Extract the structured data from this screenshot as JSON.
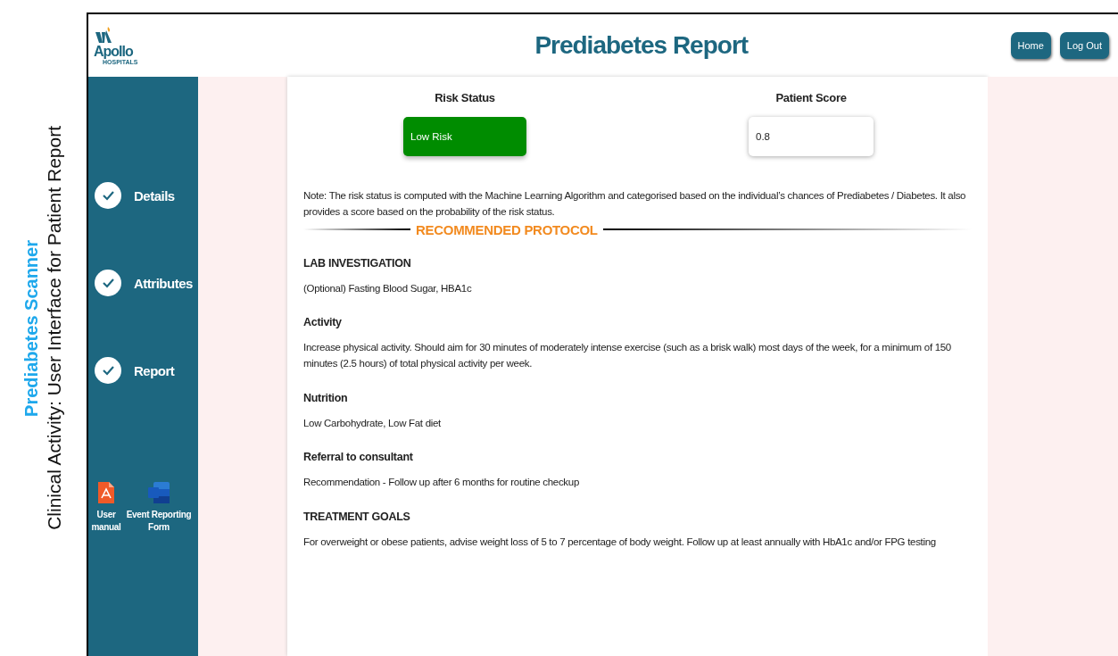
{
  "caption": {
    "title": "Prediabetes Scanner",
    "subtitle": "Clinical Activity: User Interface for Patient Report"
  },
  "header": {
    "logo": {
      "name": "Apollo",
      "sub": "HOSPITALS"
    },
    "title": "Prediabetes Report",
    "buttons": [
      "Home",
      "Log Out"
    ]
  },
  "sidebar": {
    "steps": [
      {
        "label": "Details",
        "done": true
      },
      {
        "label": "Attributes",
        "done": true
      },
      {
        "label": "Report",
        "done": true
      }
    ],
    "documents": [
      {
        "kind": "pdf",
        "label": "User manual"
      },
      {
        "kind": "word",
        "label": "Event Reporting Form"
      }
    ]
  },
  "result": {
    "risk_label": "Risk Status",
    "risk_value": "Low Risk",
    "score_label": "Patient Score",
    "score_value": "0.8"
  },
  "note": "Note: The risk status is computed with the Machine Learning Algorithm and categorised based on the individual’s chances of Prediabetes / Diabetes. It also provides a score based on the probability of the risk status.",
  "protocol_title": "RECOMMENDED PROTOCOL",
  "sections": [
    {
      "heading": "LAB INVESTIGATION",
      "text": "(Optional) Fasting Blood Sugar, HBA1c"
    },
    {
      "heading": "Activity",
      "text": "Increase physical activity. Should aim for 30 minutes of moderately intense exercise (such as a brisk walk) most days of the week, for a minimum of 150 minutes (2.5 hours) of total physical activity per week."
    },
    {
      "heading": "Nutrition",
      "text": "Low Carbohydrate, Low Fat diet"
    },
    {
      "heading": "Referral to consultant",
      "text": "Recommendation - Follow up after 6 months for routine checkup"
    },
    {
      "heading": "TREATMENT GOALS",
      "text": "For overweight or obese patients, advise weight loss of 5 to 7 percentage of body weight. Follow up at least annually with HbA1c and/or FPG testing"
    }
  ]
}
